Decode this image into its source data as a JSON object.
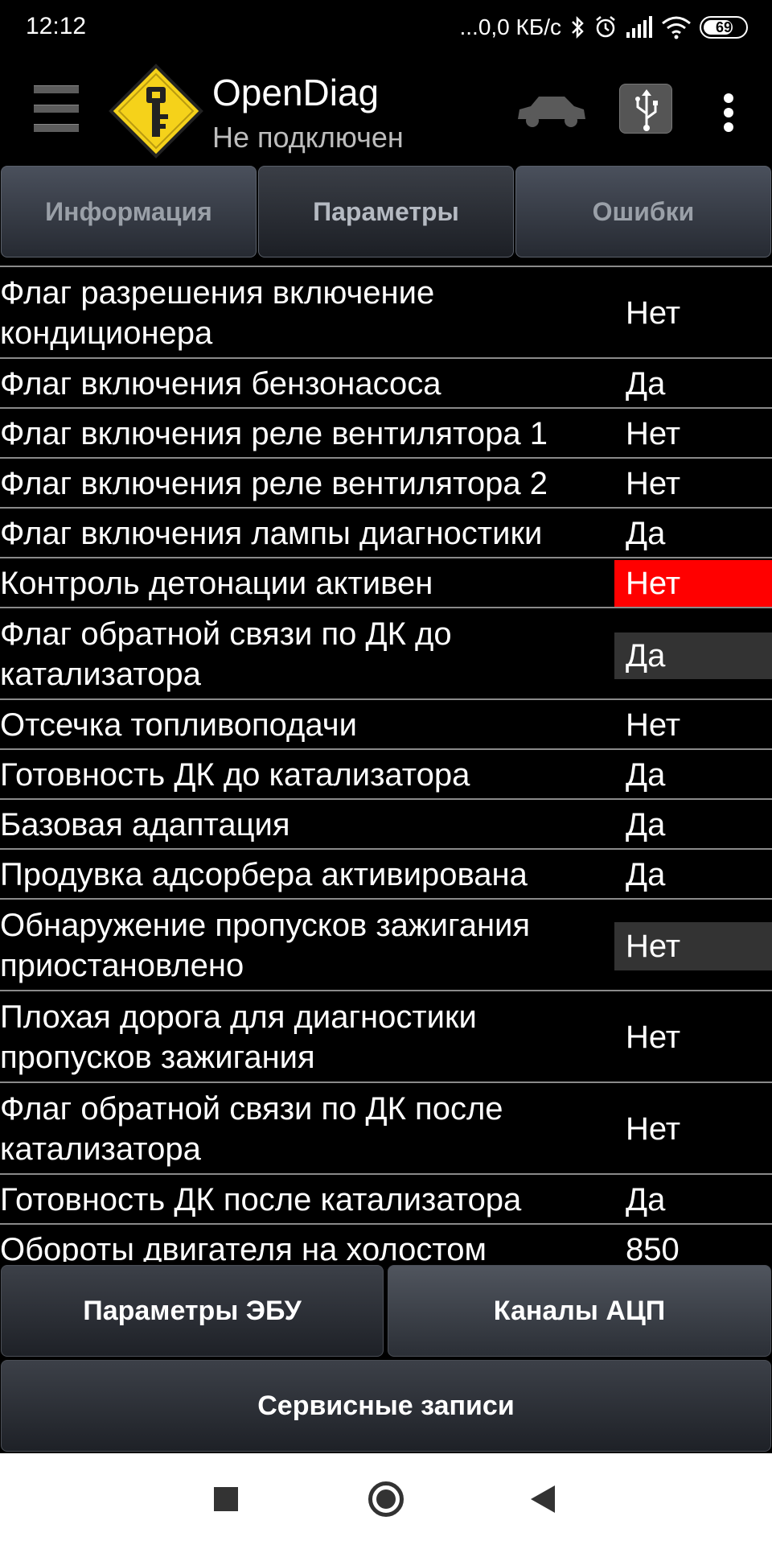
{
  "status_bar": {
    "time": "12:12",
    "network_speed": "...0,0 КБ/с",
    "battery": "69",
    "icons": [
      "bluetooth-icon",
      "alarm-icon",
      "signal-icon",
      "wifi-icon",
      "battery-icon"
    ]
  },
  "app_bar": {
    "title": "OpenDiag",
    "subtitle": "Не подключен",
    "icons": [
      "menu-icon",
      "app-logo",
      "car-icon",
      "usb-icon",
      "more-vert-icon"
    ]
  },
  "tabs": [
    {
      "label": "Информация"
    },
    {
      "label": "Параметры",
      "active": true
    },
    {
      "label": "Ошибки"
    }
  ],
  "params": [
    {
      "label": "Флаг разрешения включение\nкондиционера",
      "value": "Нет"
    },
    {
      "label": "Флаг включения бензонасоса",
      "value": "Да"
    },
    {
      "label": "Флаг включения реле вентилятора 1",
      "value": "Нет"
    },
    {
      "label": "Флаг включения реле вентилятора 2",
      "value": "Нет"
    },
    {
      "label": "Флаг включения лампы диагностики",
      "value": "Да"
    },
    {
      "label": "Контроль детонации активен",
      "value": "Нет",
      "highlight": "red"
    },
    {
      "label": "Флаг обратной связи по ДК до\nкатализатора",
      "value": "Да",
      "highlight": "gray"
    },
    {
      "label": "Отсечка топливоподачи",
      "value": "Нет"
    },
    {
      "label": "Готовность ДК до катализатора",
      "value": "Да"
    },
    {
      "label": "Базовая адаптация",
      "value": "Да"
    },
    {
      "label": "Продувка адсорбера активирована",
      "value": "Да"
    },
    {
      "label": "Обнаружение пропусков зажигания\nприостановлено",
      "value": "Нет",
      "highlight": "gray"
    },
    {
      "label": "Плохая дорога для диагностики\nпропусков зажигания",
      "value": "Нет"
    },
    {
      "label": "Флаг обратной связи по ДК после\nкатализатора",
      "value": "Нет"
    },
    {
      "label": "Готовность ДК после катализатора",
      "value": "Да"
    },
    {
      "label": "Обороты двигателя на холостом",
      "value": "850"
    }
  ],
  "buttons": {
    "ecu_params": "Параметры ЭБУ",
    "adc_channels": "Каналы АЦП",
    "service_records": "Сервисные записи"
  },
  "colors": {
    "highlight_red": "#ff0000",
    "highlight_gray": "#333333",
    "separator": "#8a8a8a",
    "logo_yellow": "#f5d21a"
  }
}
